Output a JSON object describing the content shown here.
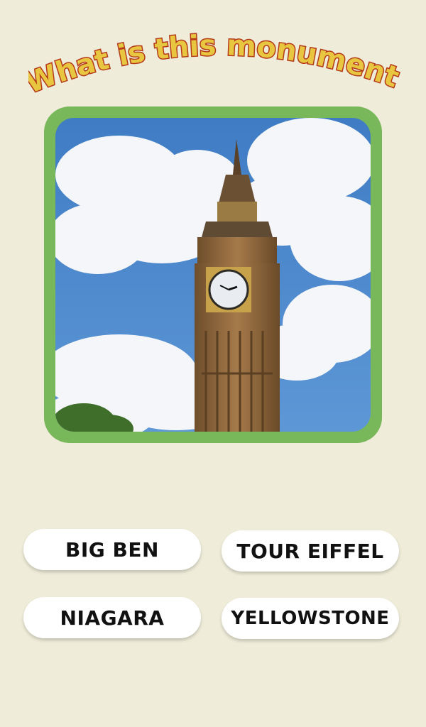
{
  "question": {
    "text": "What is this monument?"
  },
  "image": {
    "subject": "clock-tower-photo"
  },
  "answers": [
    {
      "label": "BIG BEN"
    },
    {
      "label": "TOUR EIFFEL"
    },
    {
      "label": "NIAGARA"
    },
    {
      "label": "YELLOWSTONE"
    }
  ],
  "colors": {
    "background": "#efecd9",
    "frame": "#79b85a",
    "title_fill": "#e8c640",
    "title_stroke": "#b53a1a",
    "button": "#ffffff"
  }
}
